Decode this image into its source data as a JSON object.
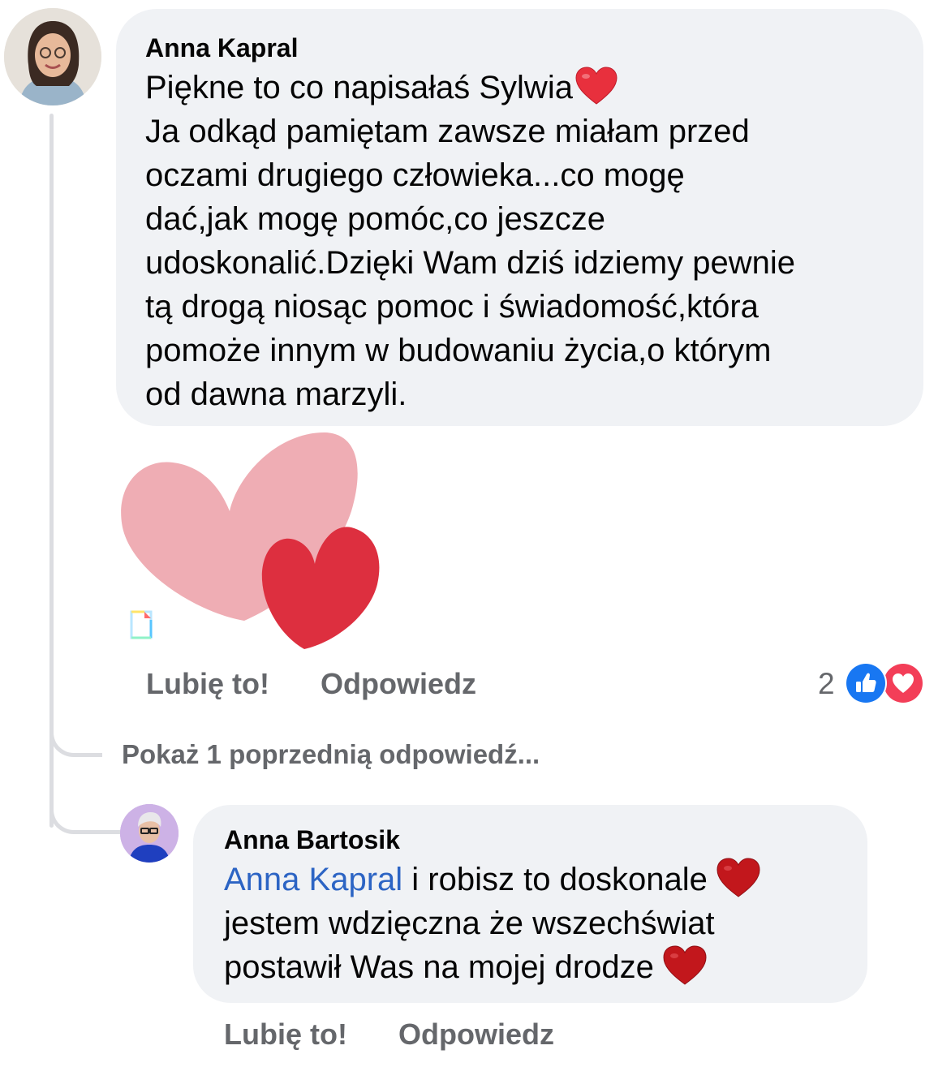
{
  "comment": {
    "author": "Anna Kapral",
    "lines": [
      "Piękne to co napisałaś Sylwia",
      "Ja odkąd pamiętam zawsze miałam przed",
      "oczami drugiego człowieka...co mogę",
      "dać,jak mogę pomóc,co jeszcze",
      "udoskonalić.Dzięki Wam dziś idziemy pewnie",
      "tą drogą niosąc pomoc i świadomość,która",
      "pomoże innym w budowaniu życia,o którym",
      "od dawna marzyli."
    ],
    "sticker_icon": "two-hearts-sticker",
    "like_label": "Lubię to!",
    "reply_label": "Odpowiedz",
    "reaction_count": "2",
    "reaction_icons": [
      "like-reaction-icon",
      "love-reaction-icon"
    ]
  },
  "show_previous_replies": "Pokaż 1 poprzednią odpowiedź...",
  "reply": {
    "author": "Anna Bartosik",
    "mention": "Anna Kapral",
    "line1_rest": " i robisz to doskonale",
    "line2": "jestem wdzięczna że wszechświat",
    "line3": "postawił Was na mojej drodze",
    "like_label": "Lubię to!",
    "reply_label": "Odpowiedz"
  },
  "colors": {
    "bubble": "#f0f2f5",
    "meta_text": "#65676b",
    "mention": "#2c64c4",
    "like_blue": "#1877f2",
    "love_red": "#f33e58"
  }
}
